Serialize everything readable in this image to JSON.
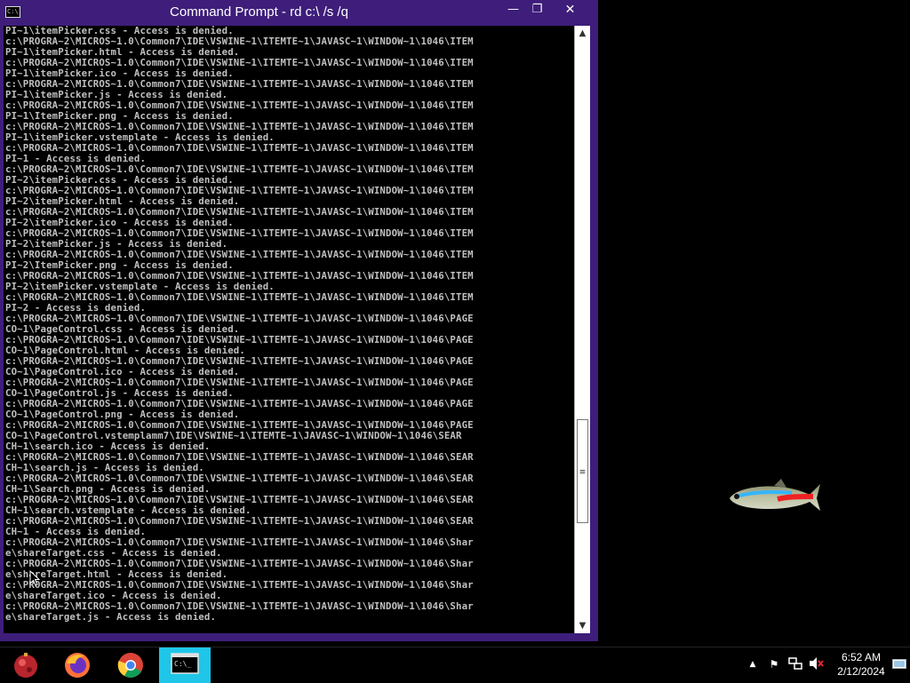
{
  "window": {
    "title": "Command Prompt - rd  c:\\ /s /q",
    "icon_text": "C:\\",
    "icon": "console-icon",
    "min_label": "—",
    "max_label": "❐",
    "close_label": "✕"
  },
  "console": {
    "lines": [
      "PI~1\\itemPicker.css - Access is denied.",
      "c:\\PROGRA~2\\MICROS~1.0\\Common7\\IDE\\VSWINE~1\\ITEMTE~1\\JAVASC~1\\WINDOW~1\\1046\\ITEM",
      "PI~1\\itemPicker.html - Access is denied.",
      "c:\\PROGRA~2\\MICROS~1.0\\Common7\\IDE\\VSWINE~1\\ITEMTE~1\\JAVASC~1\\WINDOW~1\\1046\\ITEM",
      "PI~1\\itemPicker.ico - Access is denied.",
      "c:\\PROGRA~2\\MICROS~1.0\\Common7\\IDE\\VSWINE~1\\ITEMTE~1\\JAVASC~1\\WINDOW~1\\1046\\ITEM",
      "PI~1\\itemPicker.js - Access is denied.",
      "c:\\PROGRA~2\\MICROS~1.0\\Common7\\IDE\\VSWINE~1\\ITEMTE~1\\JAVASC~1\\WINDOW~1\\1046\\ITEM",
      "PI~1\\ItemPicker.png - Access is denied.",
      "c:\\PROGRA~2\\MICROS~1.0\\Common7\\IDE\\VSWINE~1\\ITEMTE~1\\JAVASC~1\\WINDOW~1\\1046\\ITEM",
      "PI~1\\itemPicker.vstemplate - Access is denied.",
      "c:\\PROGRA~2\\MICROS~1.0\\Common7\\IDE\\VSWINE~1\\ITEMTE~1\\JAVASC~1\\WINDOW~1\\1046\\ITEM",
      "PI~1 - Access is denied.",
      "c:\\PROGRA~2\\MICROS~1.0\\Common7\\IDE\\VSWINE~1\\ITEMTE~1\\JAVASC~1\\WINDOW~1\\1046\\ITEM",
      "PI~2\\itemPicker.css - Access is denied.",
      "c:\\PROGRA~2\\MICROS~1.0\\Common7\\IDE\\VSWINE~1\\ITEMTE~1\\JAVASC~1\\WINDOW~1\\1046\\ITEM",
      "PI~2\\itemPicker.html - Access is denied.",
      "c:\\PROGRA~2\\MICROS~1.0\\Common7\\IDE\\VSWINE~1\\ITEMTE~1\\JAVASC~1\\WINDOW~1\\1046\\ITEM",
      "PI~2\\itemPicker.ico - Access is denied.",
      "c:\\PROGRA~2\\MICROS~1.0\\Common7\\IDE\\VSWINE~1\\ITEMTE~1\\JAVASC~1\\WINDOW~1\\1046\\ITEM",
      "PI~2\\itemPicker.js - Access is denied.",
      "c:\\PROGRA~2\\MICROS~1.0\\Common7\\IDE\\VSWINE~1\\ITEMTE~1\\JAVASC~1\\WINDOW~1\\1046\\ITEM",
      "PI~2\\ItemPicker.png - Access is denied.",
      "c:\\PROGRA~2\\MICROS~1.0\\Common7\\IDE\\VSWINE~1\\ITEMTE~1\\JAVASC~1\\WINDOW~1\\1046\\ITEM",
      "PI~2\\itemPicker.vstemplate - Access is denied.",
      "c:\\PROGRA~2\\MICROS~1.0\\Common7\\IDE\\VSWINE~1\\ITEMTE~1\\JAVASC~1\\WINDOW~1\\1046\\ITEM",
      "PI~2 - Access is denied.",
      "c:\\PROGRA~2\\MICROS~1.0\\Common7\\IDE\\VSWINE~1\\ITEMTE~1\\JAVASC~1\\WINDOW~1\\1046\\PAGE",
      "CO~1\\PageControl.css - Access is denied.",
      "c:\\PROGRA~2\\MICROS~1.0\\Common7\\IDE\\VSWINE~1\\ITEMTE~1\\JAVASC~1\\WINDOW~1\\1046\\PAGE",
      "CO~1\\PageControl.html - Access is denied.",
      "c:\\PROGRA~2\\MICROS~1.0\\Common7\\IDE\\VSWINE~1\\ITEMTE~1\\JAVASC~1\\WINDOW~1\\1046\\PAGE",
      "CO~1\\PageControl.ico - Access is denied.",
      "c:\\PROGRA~2\\MICROS~1.0\\Common7\\IDE\\VSWINE~1\\ITEMTE~1\\JAVASC~1\\WINDOW~1\\1046\\PAGE",
      "CO~1\\PageControl.js - Access is denied.",
      "c:\\PROGRA~2\\MICROS~1.0\\Common7\\IDE\\VSWINE~1\\ITEMTE~1\\JAVASC~1\\WINDOW~1\\1046\\PAGE",
      "CO~1\\PageControl.png - Access is denied.",
      "c:\\PROGRA~2\\MICROS~1.0\\Common7\\IDE\\VSWINE~1\\ITEMTE~1\\JAVASC~1\\WINDOW~1\\1046\\PAGE",
      "CO~1\\PageControl.vstemplamm7\\IDE\\VSWINE~1\\ITEMTE~1\\JAVASC~1\\WINDOW~1\\1046\\SEAR",
      "CH~1\\search.ico - Access is denied.",
      "c:\\PROGRA~2\\MICROS~1.0\\Common7\\IDE\\VSWINE~1\\ITEMTE~1\\JAVASC~1\\WINDOW~1\\1046\\SEAR",
      "CH~1\\search.js - Access is denied.",
      "c:\\PROGRA~2\\MICROS~1.0\\Common7\\IDE\\VSWINE~1\\ITEMTE~1\\JAVASC~1\\WINDOW~1\\1046\\SEAR",
      "CH~1\\Search.png - Access is denied.",
      "c:\\PROGRA~2\\MICROS~1.0\\Common7\\IDE\\VSWINE~1\\ITEMTE~1\\JAVASC~1\\WINDOW~1\\1046\\SEAR",
      "CH~1\\search.vstemplate - Access is denied.",
      "c:\\PROGRA~2\\MICROS~1.0\\Common7\\IDE\\VSWINE~1\\ITEMTE~1\\JAVASC~1\\WINDOW~1\\1046\\SEAR",
      "CH~1 - Access is denied.",
      "c:\\PROGRA~2\\MICROS~1.0\\Common7\\IDE\\VSWINE~1\\ITEMTE~1\\JAVASC~1\\WINDOW~1\\1046\\Shar",
      "e\\shareTarget.css - Access is denied.",
      "c:\\PROGRA~2\\MICROS~1.0\\Common7\\IDE\\VSWINE~1\\ITEMTE~1\\JAVASC~1\\WINDOW~1\\1046\\Shar",
      "e\\shareTarget.html - Access is denied.",
      "c:\\PROGRA~2\\MICROS~1.0\\Common7\\IDE\\VSWINE~1\\ITEMTE~1\\JAVASC~1\\WINDOW~1\\1046\\Shar",
      "e\\shareTarget.ico - Access is denied.",
      "c:\\PROGRA~2\\MICROS~1.0\\Common7\\IDE\\VSWINE~1\\ITEMTE~1\\JAVASC~1\\WINDOW~1\\1046\\Shar",
      "e\\shareTarget.js - Access is denied."
    ]
  },
  "scrollbar": {
    "up_arrow": "▲",
    "down_arrow": "▼",
    "grip": "≡",
    "thumb_position_fraction": 0.8,
    "thumb_size_fraction": 0.18
  },
  "desktop": {
    "wallpaper_item": "neon-tetra-fish"
  },
  "taskbar": {
    "apps": [
      {
        "name": "start",
        "icon": "start-orb-icon"
      },
      {
        "name": "Firefox",
        "icon": "firefox-icon"
      },
      {
        "name": "Chrome",
        "icon": "chrome-icon"
      },
      {
        "name": "Command Prompt",
        "icon": "console-icon",
        "active": true
      }
    ],
    "tray": {
      "chevron": "▲",
      "flag": "⚑",
      "network": "🖧",
      "volume": "🔇"
    },
    "clock": {
      "time": "6:52 AM",
      "date": "2/12/2024"
    }
  },
  "colors": {
    "window_frame": "#3e1e7a",
    "console_bg": "#000000",
    "console_text": "#c0c0c0",
    "active_task": "#1fc6e8"
  }
}
